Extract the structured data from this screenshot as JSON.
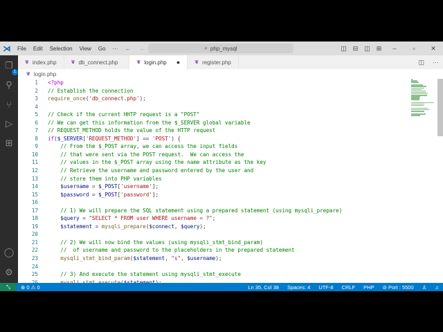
{
  "titlebar": {
    "menus": [
      "File",
      "Edit",
      "Selection",
      "View",
      "Go",
      "···"
    ],
    "search": "php_mysql"
  },
  "activity": {
    "explorer_badge": "1"
  },
  "tabs": [
    {
      "label": "index.php"
    },
    {
      "label": "db_connect.php"
    },
    {
      "label": "login.php",
      "active": true,
      "modified": true
    },
    {
      "label": "register.php"
    }
  ],
  "breadcrumb": "login.php",
  "code": [
    [
      [
        "p",
        "<?php"
      ]
    ],
    [
      [
        "c",
        "// Establish the connection"
      ]
    ],
    [
      [
        "f",
        "require_once"
      ],
      [
        "t",
        "("
      ],
      [
        "s",
        "'db_connect.php'"
      ],
      [
        "t",
        ");"
      ]
    ],
    [],
    [
      [
        "c",
        "// Check if the current HHTP request is a \"POST\""
      ]
    ],
    [
      [
        "c",
        "// We can get this information from the $_SERVER global variable"
      ]
    ],
    [
      [
        "c",
        "// REQUEST_METHOD holds the value of the HTTP request"
      ]
    ],
    [
      [
        "p",
        "if"
      ],
      [
        "t",
        "("
      ],
      [
        "v",
        "$_SERVER"
      ],
      [
        "t",
        "["
      ],
      [
        "s",
        "'REQUEST_METHOD'"
      ],
      [
        "t",
        "] == "
      ],
      [
        "s",
        "'POST'"
      ],
      [
        "t",
        ") {"
      ]
    ],
    [
      [
        "t",
        "    "
      ],
      [
        "c",
        "// From the $_POST array, we can access the input fields"
      ]
    ],
    [
      [
        "t",
        "    "
      ],
      [
        "c",
        "// that were sent via the POST request.  We can access the"
      ]
    ],
    [
      [
        "t",
        "    "
      ],
      [
        "c",
        "// values in the $_POST array using the name attribute as the key"
      ]
    ],
    [
      [
        "t",
        "    "
      ],
      [
        "c",
        "// Retrieve the username and password entered by the user and"
      ]
    ],
    [
      [
        "t",
        "    "
      ],
      [
        "c",
        "// store them into PHP variables"
      ]
    ],
    [
      [
        "t",
        "    "
      ],
      [
        "v",
        "$username"
      ],
      [
        "t",
        " = "
      ],
      [
        "v",
        "$_POST"
      ],
      [
        "t",
        "["
      ],
      [
        "s",
        "'username'"
      ],
      [
        "t",
        "];"
      ]
    ],
    [
      [
        "t",
        "    "
      ],
      [
        "v",
        "$password"
      ],
      [
        "t",
        " = "
      ],
      [
        "v",
        "$_POST"
      ],
      [
        "t",
        "["
      ],
      [
        "s",
        "'password'"
      ],
      [
        "t",
        "];"
      ]
    ],
    [],
    [
      [
        "t",
        "    "
      ],
      [
        "c",
        "// 1) We will prepare the SQL statement using a prepared statement (using mysqli_prepare)"
      ]
    ],
    [
      [
        "t",
        "    "
      ],
      [
        "v",
        "$query"
      ],
      [
        "t",
        " = "
      ],
      [
        "s",
        "\"SELECT * FROM user WHERE username = ?\""
      ],
      [
        "t",
        ";"
      ]
    ],
    [
      [
        "t",
        "    "
      ],
      [
        "v",
        "$statement"
      ],
      [
        "t",
        " = "
      ],
      [
        "f",
        "mysqli_prepare"
      ],
      [
        "t",
        "("
      ],
      [
        "v",
        "$connect"
      ],
      [
        "t",
        ", "
      ],
      [
        "v",
        "$query"
      ],
      [
        "t",
        ");"
      ]
    ],
    [],
    [
      [
        "t",
        "    "
      ],
      [
        "c",
        "// 2) We will now bind the values (using mysqli_stmt_bind_param)"
      ]
    ],
    [
      [
        "t",
        "    "
      ],
      [
        "c",
        "//  of username and password to the placeholders in the prepared statement"
      ]
    ],
    [
      [
        "t",
        "    "
      ],
      [
        "f",
        "mysqli_stmt_bind_param"
      ],
      [
        "t",
        "("
      ],
      [
        "v",
        "$statement"
      ],
      [
        "t",
        ", "
      ],
      [
        "s",
        "\"s\""
      ],
      [
        "t",
        ", "
      ],
      [
        "v",
        "$username"
      ],
      [
        "t",
        ");"
      ]
    ],
    [],
    [
      [
        "t",
        "    "
      ],
      [
        "c",
        "// 3) And execute the statement using mysqli_stmt_execute"
      ]
    ],
    [
      [
        "t",
        "    "
      ],
      [
        "f",
        "mysqli_stmt_execute"
      ],
      [
        "t",
        "("
      ],
      [
        "v",
        "$statement"
      ],
      [
        "t",
        ");"
      ]
    ]
  ],
  "status": {
    "errors": "0",
    "warnings": "0",
    "position": "Ln 35, Col 38",
    "spaces": "Spaces: 4",
    "encoding": "UTF-8",
    "eol": "CRLF",
    "language": "PHP",
    "port": "⊘ Port : 5500"
  }
}
